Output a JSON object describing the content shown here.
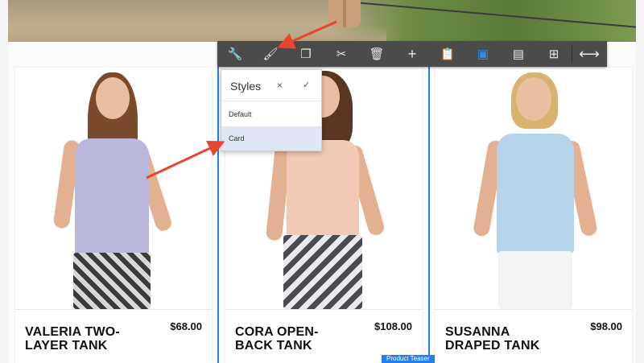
{
  "toolbar": {
    "buttons": [
      {
        "icon": "wrench-icon",
        "glyph": "🔧"
      },
      {
        "icon": "brush-icon",
        "glyph": "🖌"
      },
      {
        "icon": "copy-icon",
        "glyph": "❐"
      },
      {
        "icon": "scissors-icon",
        "glyph": "✂"
      },
      {
        "icon": "trash-icon",
        "glyph": "🗑"
      },
      {
        "icon": "plus-icon",
        "glyph": "+"
      },
      {
        "icon": "clipboard-icon",
        "glyph": "📋"
      },
      {
        "icon": "select-frame-icon",
        "glyph": "▣"
      },
      {
        "icon": "layout-icon",
        "glyph": "▤"
      },
      {
        "icon": "insert-component-icon",
        "glyph": "⊞"
      },
      {
        "icon": "resize-horizontal-icon",
        "glyph": "⟷"
      }
    ]
  },
  "styles_popover": {
    "title": "Styles",
    "close": "×",
    "confirm": "✓",
    "options": [
      "Default",
      "Card"
    ],
    "selected": "Card"
  },
  "products": [
    {
      "name": "VALERIA TWO-LAYER TANK",
      "price": "$68.00"
    },
    {
      "name": "CORA OPEN-BACK TANK",
      "price": "$108.00"
    },
    {
      "name": "SUSANNA DRAPED TANK",
      "price": "$98.00"
    }
  ],
  "badge": "Product Teaser",
  "colors": {
    "toolbar_bg": "#4b4b4b",
    "selection_blue": "#2680eb",
    "arrow_red": "#e8452e"
  }
}
